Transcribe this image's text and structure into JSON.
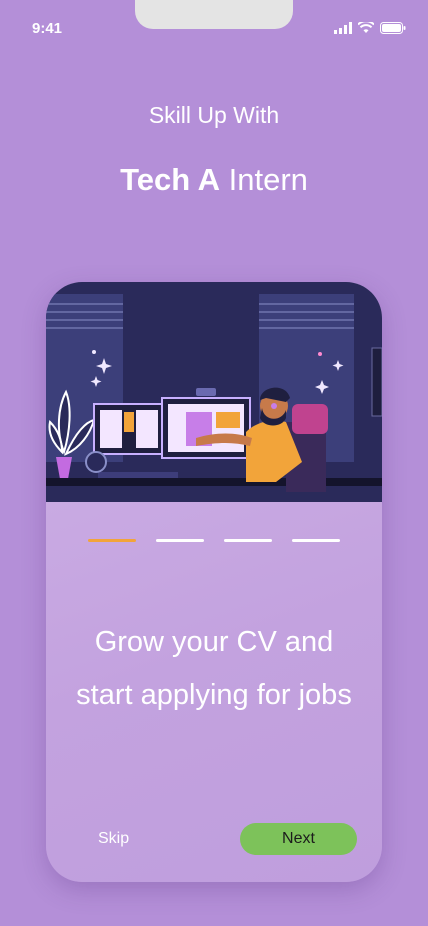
{
  "status_bar": {
    "time": "9:41"
  },
  "header": {
    "subtitle": "Skill Up With",
    "brand_bold": "Tech A",
    "brand_light": "Intern"
  },
  "onboarding": {
    "headline": "Grow your CV and start applying for jobs",
    "page_index": 1,
    "page_count": 4,
    "skip_label": "Skip",
    "next_label": "Next"
  },
  "colors": {
    "background": "#b48fd8",
    "accent_indicator": "#f2a43a",
    "next_button": "#7dc25a"
  }
}
